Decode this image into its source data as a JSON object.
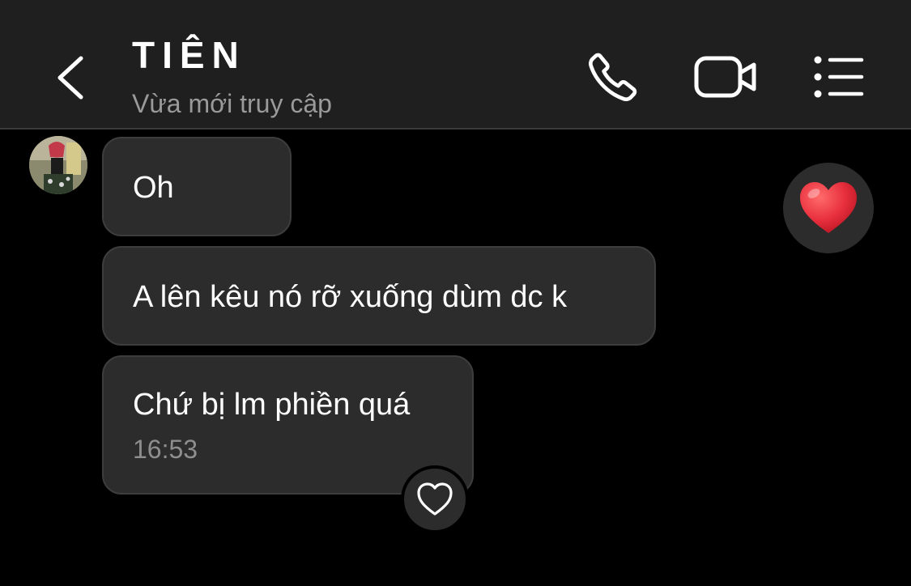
{
  "header": {
    "name": "TIÊN",
    "status": "Vừa mới truy cập",
    "icons": {
      "back": "chevron-left-icon",
      "call": "phone-icon",
      "video": "video-camera-icon",
      "details": "list-icon"
    }
  },
  "messages": [
    {
      "text": "Oh"
    },
    {
      "text": "A lên kêu nó rỡ xuống dùm dc k"
    },
    {
      "text": "Chứ bị lm phiền quá",
      "time": "16:53"
    }
  ],
  "reactions": {
    "like_icon": "heart-outline-icon",
    "quick_react_icon": "red-heart-icon"
  },
  "colors": {
    "background": "#000000",
    "header": "#1f1f1f",
    "bubble": "#2c2c2c",
    "heart": "#e8303e",
    "muted_text": "#9a9a9a"
  }
}
